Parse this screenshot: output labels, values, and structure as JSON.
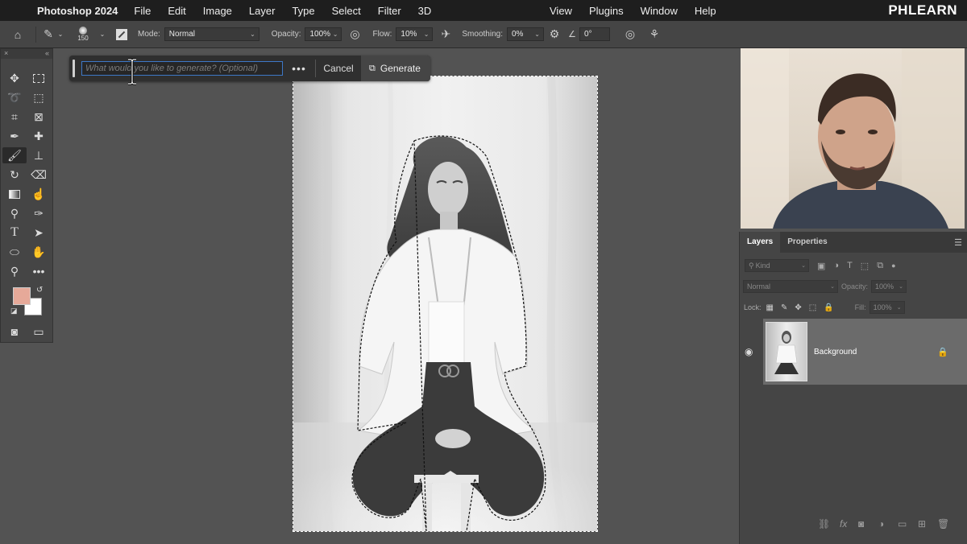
{
  "menubar": {
    "app_name": "Photoshop 2024",
    "items": [
      "File",
      "Edit",
      "Image",
      "Layer",
      "Type",
      "Select",
      "Filter",
      "3D"
    ],
    "right_items": [
      "View",
      "Plugins",
      "Window",
      "Help"
    ],
    "brand": "PHLEARN"
  },
  "options": {
    "brush_size": "150",
    "mode_label": "Mode:",
    "mode_value": "Normal",
    "opacity_label": "Opacity:",
    "opacity_value": "100%",
    "flow_label": "Flow:",
    "flow_value": "10%",
    "smoothing_label": "Smoothing:",
    "smoothing_value": "0%",
    "angle_value": "0°"
  },
  "toolbox": {
    "close": "×",
    "collapse": "«",
    "tools": [
      "move-tool",
      "marquee-tool",
      "lasso-tool",
      "object-select-tool",
      "crop-tool",
      "frame-tool",
      "eyedropper-tool",
      "healing-tool",
      "brush-tool",
      "stamp-tool",
      "history-brush-tool",
      "eraser-tool",
      "gradient-tool",
      "smudge-tool",
      "dodge-tool",
      "pen-tool",
      "type-tool",
      "path-select-tool",
      "ellipse-tool",
      "hand-tool",
      "zoom-tool",
      "more-tools"
    ],
    "active_tool": "brush-tool",
    "foreground_color": "#e6a999",
    "background_color": "#ffffff"
  },
  "generate_bar": {
    "placeholder": "What would you like to generate? (Optional)",
    "more": "•••",
    "cancel": "Cancel",
    "generate": "Generate"
  },
  "layers_panel": {
    "tabs": [
      "Layers",
      "Properties"
    ],
    "active_tab": "Layers",
    "kind_label": "Kind",
    "blend_mode": "Normal",
    "opacity_label": "Opacity:",
    "opacity_value": "100%",
    "lock_label": "Lock:",
    "fill_label": "Fill:",
    "fill_value": "100%",
    "layer_name": "Background"
  }
}
